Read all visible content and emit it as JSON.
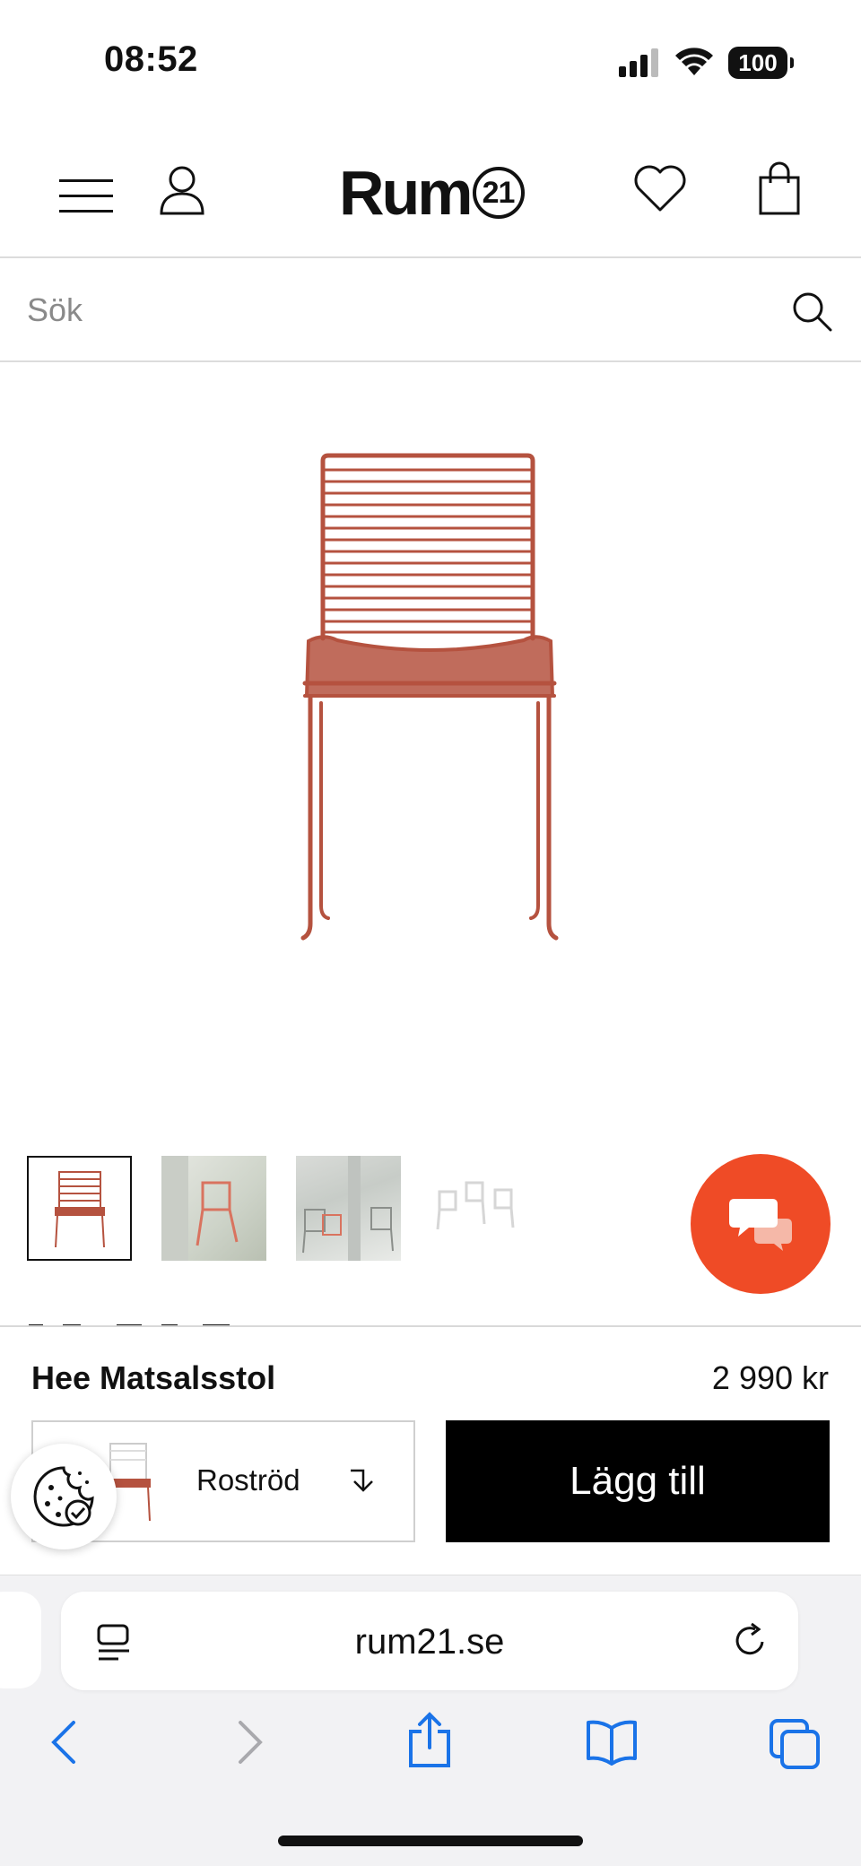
{
  "status_bar": {
    "time": "08:52",
    "battery": "100"
  },
  "header": {
    "logo_text": "Rum",
    "logo_badge": "21",
    "icons": [
      "menu-icon",
      "account-icon",
      "heart-icon",
      "shopping-bag-icon"
    ]
  },
  "search": {
    "placeholder": "Sök"
  },
  "gallery": {
    "thumbnail_count": 4,
    "active_index": 0
  },
  "product": {
    "name": "Hee Matsalsstol",
    "price": "2 990 kr",
    "variant": "Roströd",
    "add_label": "Lägg till",
    "color": "#b5523f"
  },
  "browser": {
    "url": "rum21.se"
  },
  "colors": {
    "accent": "#ef4b26",
    "button": "#000000",
    "safari_blue": "#1a73e8"
  }
}
